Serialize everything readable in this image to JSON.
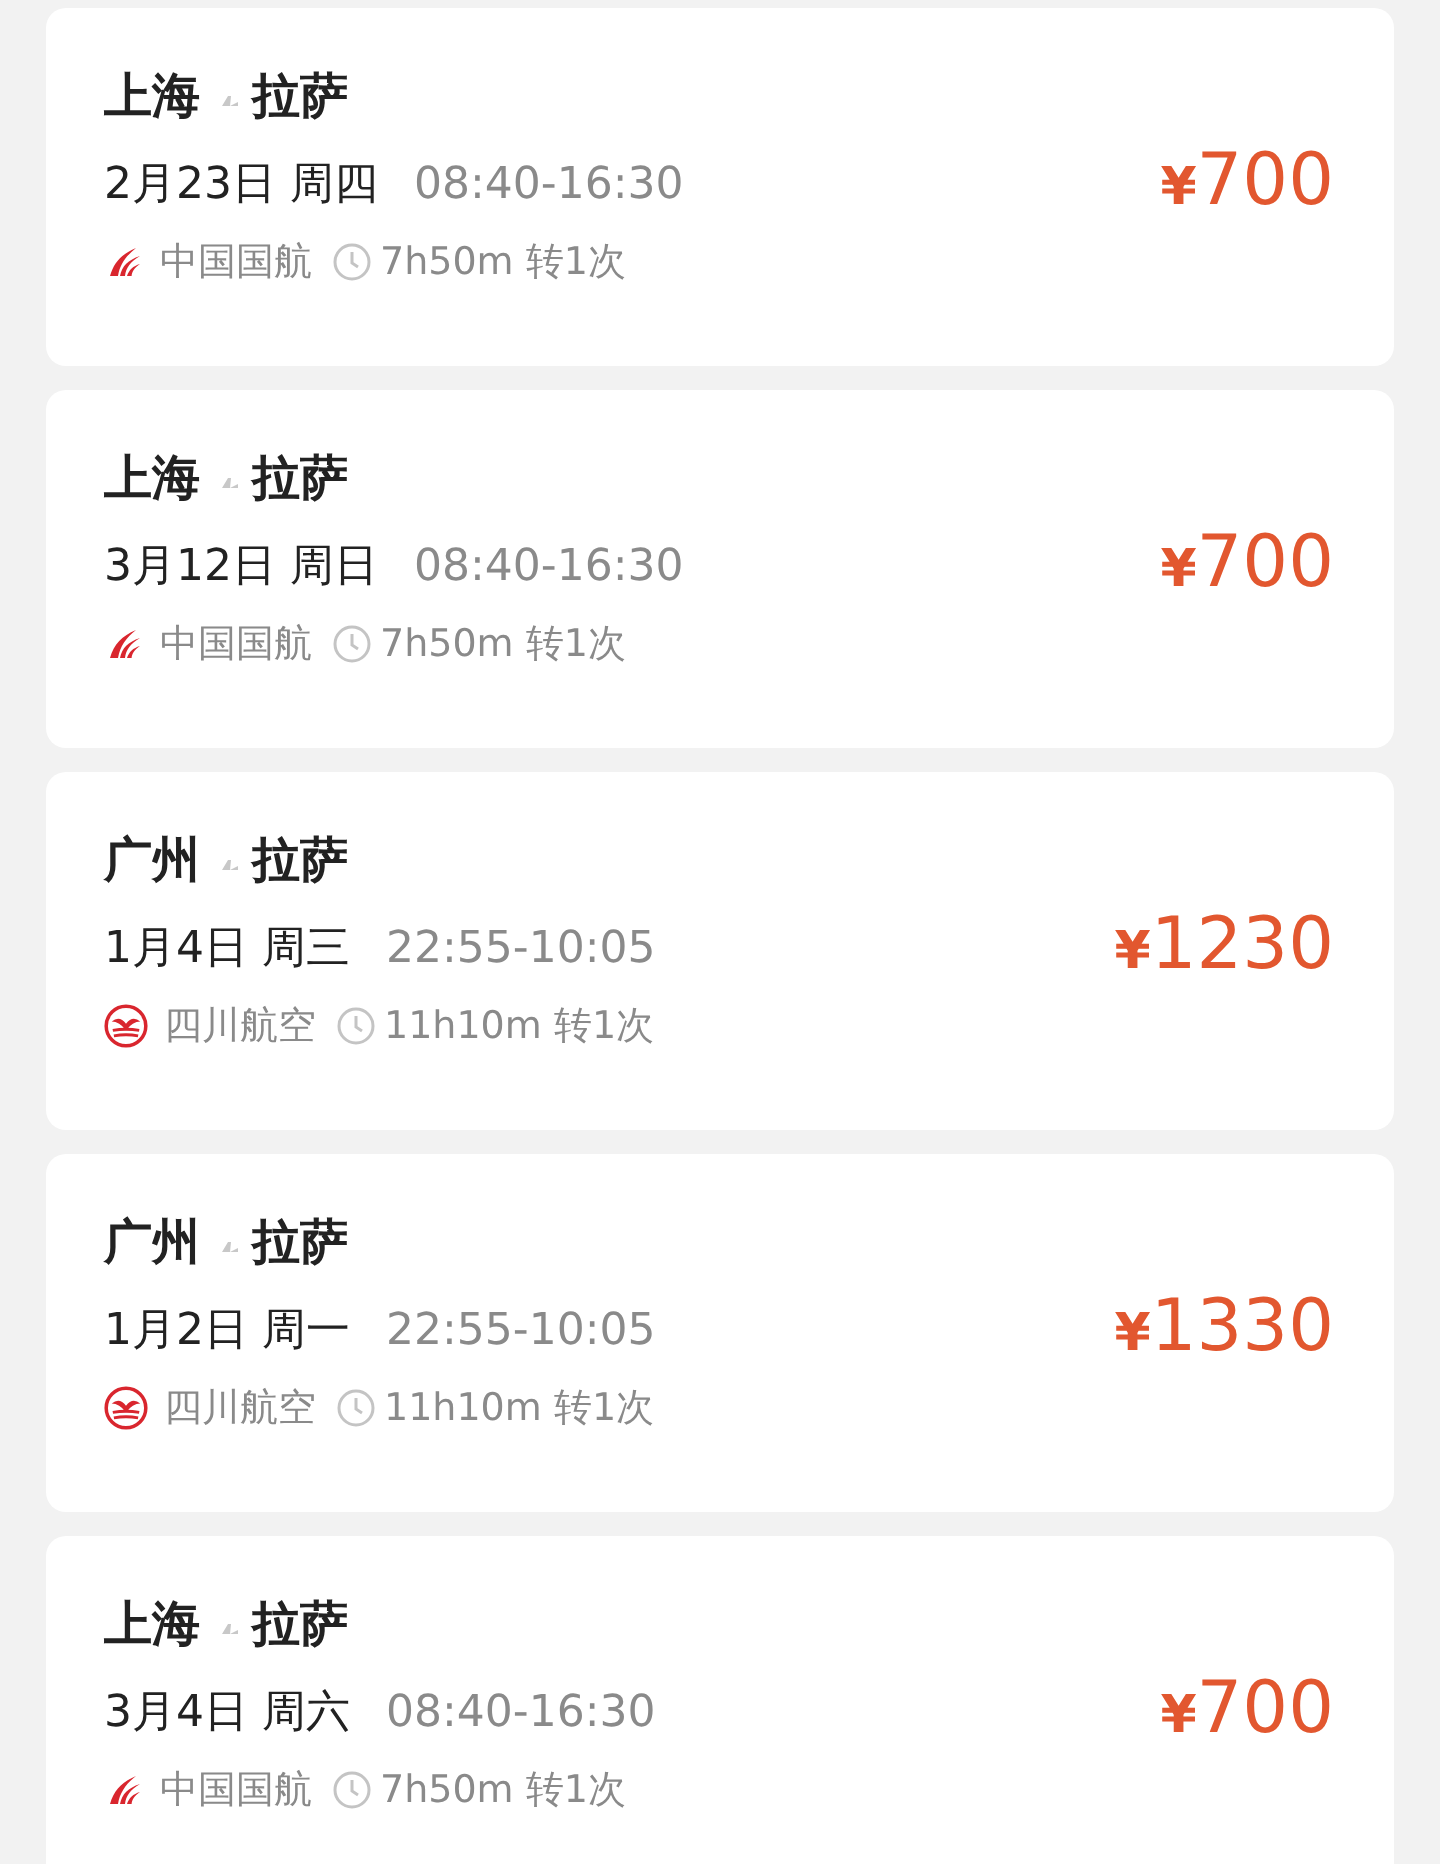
{
  "flights": [
    {
      "from": "上海",
      "to": "拉萨",
      "date": "2月23日 周四",
      "time": "08:40-16:30",
      "airline": "中国国航",
      "kind": "phoenix",
      "duration": "7h50m 转1次",
      "price": "¥700"
    },
    {
      "from": "上海",
      "to": "拉萨",
      "date": "3月12日 周日",
      "time": "08:40-16:30",
      "airline": "中国国航",
      "kind": "phoenix",
      "duration": "7h50m 转1次",
      "price": "¥700"
    },
    {
      "from": "广州",
      "to": "拉萨",
      "date": "1月4日 周三",
      "time": "22:55-10:05",
      "airline": "四川航空",
      "kind": "ring",
      "duration": "11h10m 转1次",
      "price": "¥1230"
    },
    {
      "from": "广州",
      "to": "拉萨",
      "date": "1月2日 周一",
      "time": "22:55-10:05",
      "airline": "四川航空",
      "kind": "ring",
      "duration": "11h10m 转1次",
      "price": "¥1330"
    },
    {
      "from": "上海",
      "to": "拉萨",
      "date": "3月4日 周六",
      "time": "08:40-16:30",
      "airline": "中国国航",
      "kind": "phoenix",
      "duration": "7h50m 转1次",
      "price": "¥700"
    }
  ]
}
